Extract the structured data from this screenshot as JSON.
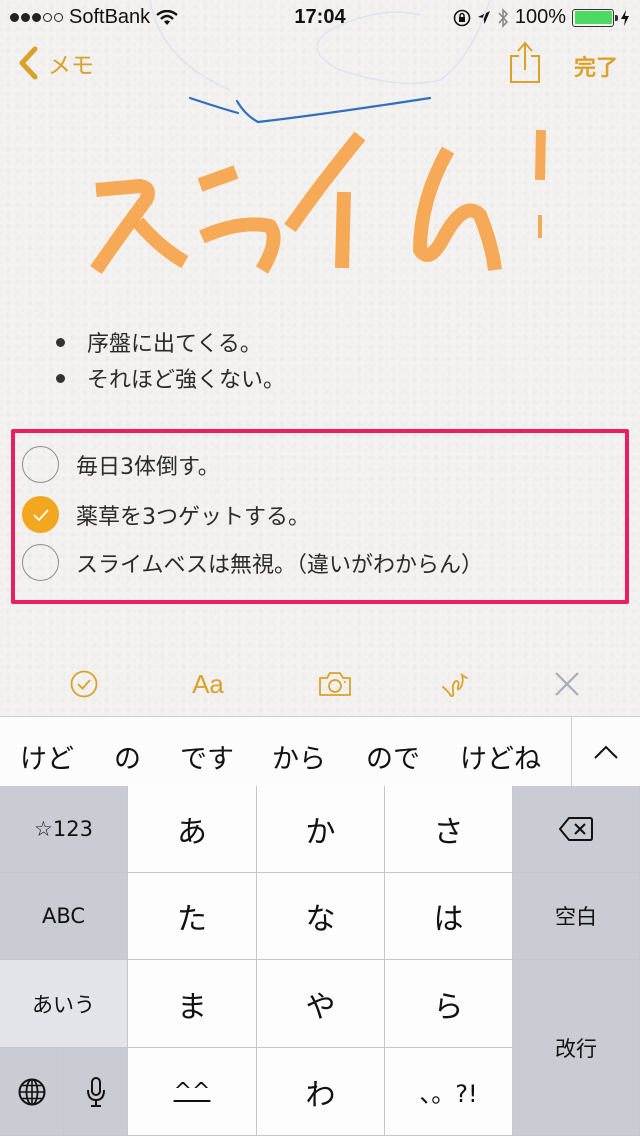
{
  "status_bar": {
    "carrier": "SoftBank",
    "signal_bars_filled": 3,
    "signal_bars_total": 5,
    "time": "17:04",
    "battery_percent": "100%",
    "battery_color": "#4cd964"
  },
  "nav": {
    "back_label": "メモ",
    "done_label": "完了",
    "accent_color": "#d9a22b"
  },
  "drawing": {
    "handwritten_text": "スライム!",
    "stroke_color": "#f6a44a",
    "blue_stroke_color": "#2f6fc0"
  },
  "bullets": [
    {
      "text": "序盤に出てくる。"
    },
    {
      "text": "それほど強くない。"
    }
  ],
  "checklist": {
    "highlight_color": "#e91e63",
    "items": [
      {
        "text": "毎日3体倒す。",
        "checked": false
      },
      {
        "text": "薬草を3つゲットする。",
        "checked": true
      },
      {
        "text": "スライムベスは無視。（違いがわからん）",
        "checked": false
      }
    ]
  },
  "toolbar": {
    "checklist_icon": "checklist-icon",
    "format_label": "Aa",
    "camera_icon": "camera-icon",
    "sketch_icon": "sketch-icon",
    "close_icon": "close-icon"
  },
  "predictions": {
    "items": [
      "けど",
      "の",
      "です",
      "から",
      "ので",
      "けどね"
    ],
    "collapse_icon": "chevron-up-icon"
  },
  "keyboard": {
    "symbols_label": "☆123",
    "abc_label": "ABC",
    "kana_label": "あいう",
    "keys_row1": [
      "あ",
      "か",
      "さ"
    ],
    "keys_row2": [
      "た",
      "な",
      "は"
    ],
    "keys_row3": [
      "ま",
      "や",
      "ら"
    ],
    "keys_row4": [
      "^^",
      "わ",
      "、。?!"
    ],
    "space_label": "空白",
    "return_label": "改行",
    "globe_icon": "globe-icon",
    "mic_icon": "microphone-icon",
    "delete_icon": "delete-icon"
  }
}
